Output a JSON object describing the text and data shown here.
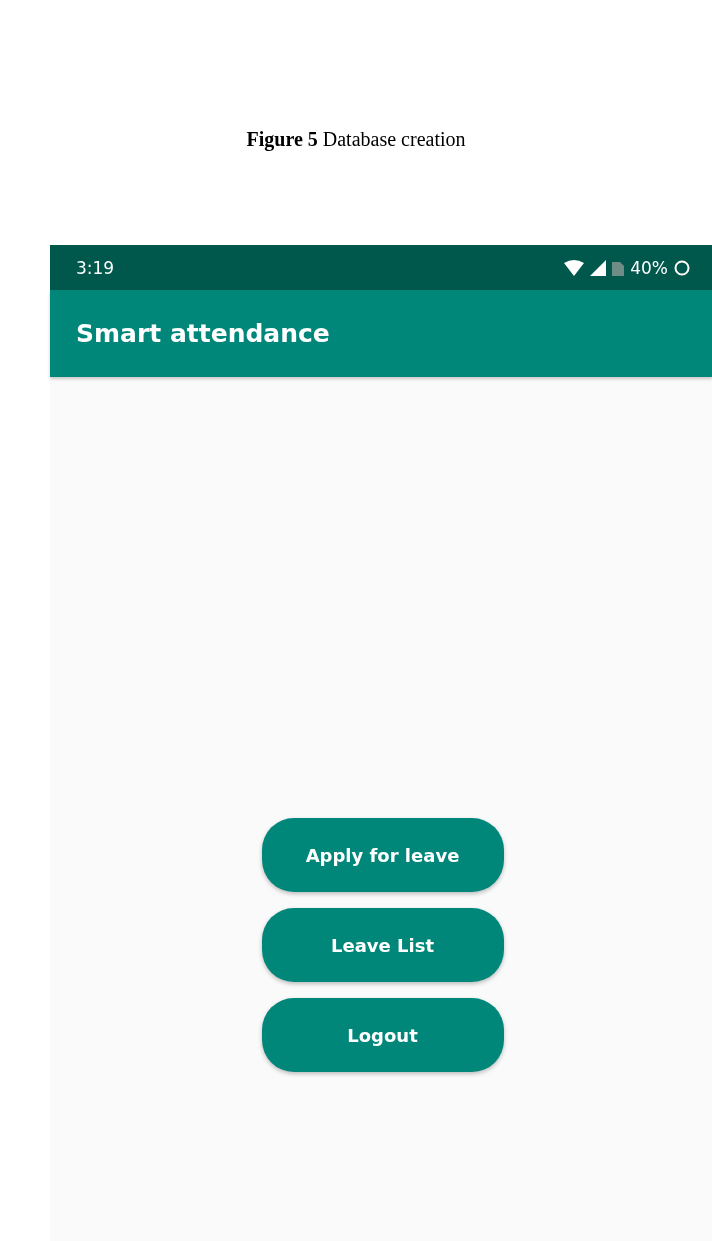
{
  "caption": {
    "number": "Figure 5",
    "text": "Database creation"
  },
  "status_bar": {
    "time": "3:19",
    "battery": "40%"
  },
  "app_bar": {
    "title": "Smart attendance"
  },
  "buttons": [
    "Apply for leave",
    "Leave List",
    "Logout"
  ]
}
